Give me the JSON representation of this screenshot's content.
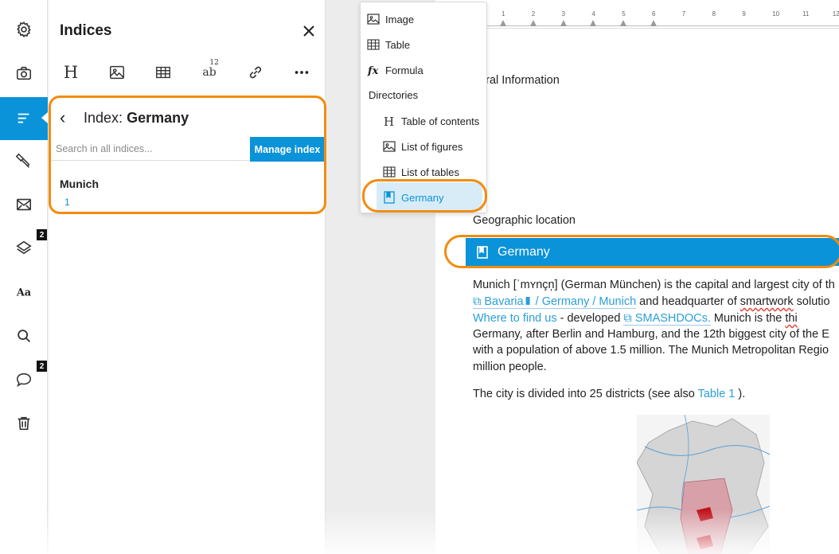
{
  "rail": {
    "badges": {
      "layers": "2",
      "comments": "2"
    },
    "icons": [
      "gear-icon",
      "camera-icon",
      "list-icon",
      "paint-brush-icon",
      "mail-icon",
      "layers-icon",
      "font-icon",
      "search-icon",
      "comment-icon",
      "trash-icon"
    ],
    "active": "list-icon"
  },
  "panel": {
    "title": "Indices",
    "close_icon": "close-icon",
    "toolbar": {
      "heading_glyph": "H",
      "superscript_glyph": "ab",
      "superscript_num": "12"
    },
    "index_label": "Index:",
    "index_name": "Germany",
    "search_placeholder": "Search in all indices...",
    "manage_button": "Manage index",
    "entries": [
      {
        "term": "Munich",
        "page": "1"
      }
    ]
  },
  "menu": {
    "items": [
      "Image",
      "Table",
      "Formula"
    ],
    "heading": "Directories",
    "directories": [
      "Table of contents",
      "List of figures",
      "List of tables",
      "Germany"
    ],
    "selected": "Germany"
  },
  "document": {
    "ruler_numbers": [
      "1",
      "2",
      "3",
      "4",
      "5",
      "6",
      "7",
      "8",
      "9",
      "10",
      "11",
      "12"
    ],
    "heading_general": "neral Information",
    "heading_geo": "Geographic location",
    "banner": "Germany",
    "para1": {
      "l1": "Munich [ˈmʏnçn̩] (German München) is the capital and largest city of th",
      "l2_link1": "Bavaria",
      "l2_link2": " / Germany / Munich",
      "l2_rest1": " and headquarter of ",
      "l2_squiggle": "smartwork",
      "l2_rest2": " solutio",
      "l3_link": "Where to find us",
      "l3_mid": " - developed ",
      "l3_link2": "SMASHDOCs.",
      "l3_rest": " Munich is the ",
      "l3_squiggle": "thi",
      "l4": "Germany, after Berlin and Hamburg, and the 12th biggest city of the E",
      "l5": "with a population of above 1.5 million. The Munich Metropolitan Regio",
      "l6": "million people."
    },
    "para2": {
      "text": "The city is divided into 25 districts (see also ",
      "link": "Table 1",
      "end": " )."
    }
  },
  "colors": {
    "accent": "#0a93d8",
    "highlight": "#f28c0f"
  }
}
